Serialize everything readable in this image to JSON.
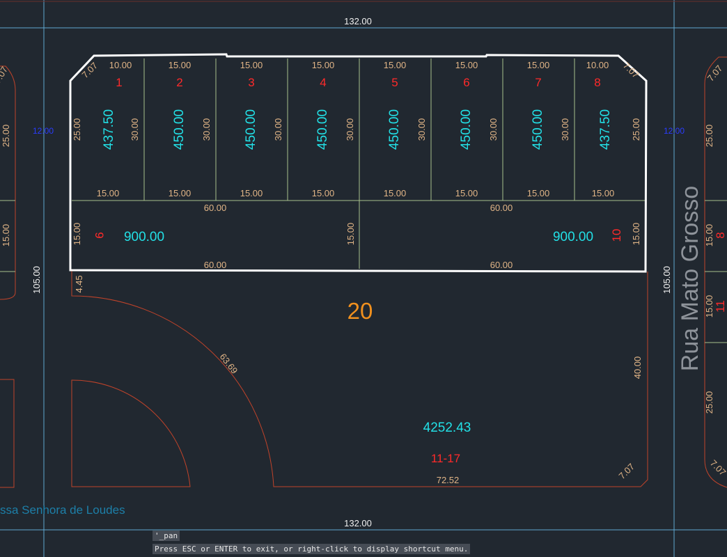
{
  "drawing": {
    "dim_top": "132.00",
    "dim_bottom": "132.00",
    "dim_left": "105.00",
    "dim_right": "105.00",
    "street_name": "Rua Mato Grosso",
    "street_name_bottom": "ssa Senhora de Loudes",
    "blue_label_left": "12.00",
    "blue_label_right": "12.00",
    "block_number": "20",
    "remainder_area": "4252.43",
    "remainder_lots": "11-17",
    "arc_length": "63.69",
    "bottom_edge": "72.52",
    "right_edge": "40.00",
    "left_offset": "4.45",
    "corner_chamfer": "7.07",
    "lots_top": [
      {
        "num": "1",
        "area": "437.50",
        "front": "10.00",
        "back": "15.00",
        "side": "25.00"
      },
      {
        "num": "2",
        "area": "450.00",
        "front": "15.00",
        "back": "15.00",
        "side": "30.00"
      },
      {
        "num": "3",
        "area": "450.00",
        "front": "15.00",
        "back": "15.00",
        "side": "30.00"
      },
      {
        "num": "4",
        "area": "450.00",
        "front": "15.00",
        "back": "15.00",
        "side": "30.00"
      },
      {
        "num": "5",
        "area": "450.00",
        "front": "15.00",
        "back": "15.00",
        "side": "30.00"
      },
      {
        "num": "6",
        "area": "450.00",
        "front": "15.00",
        "back": "15.00",
        "side": "30.00"
      },
      {
        "num": "7",
        "area": "450.00",
        "front": "15.00",
        "back": "15.00",
        "side": "30.00"
      },
      {
        "num": "8",
        "area": "437.50",
        "front": "10.00",
        "back": "15.00",
        "side": "30.00"
      }
    ],
    "lot_8_right_side": "25.00",
    "chamfer_left": "7.07",
    "chamfer_right": "7.07",
    "lot_9": {
      "num": "9",
      "area": "900.00",
      "top": "60.00",
      "bottom": "60.00",
      "side": "15.00",
      "inner_side": "15.00"
    },
    "lot_10": {
      "num": "10",
      "area": "900.00",
      "top": "60.00",
      "bottom": "60.00",
      "side": "15.00"
    },
    "adjacent_left": [
      "25.00",
      "15.00"
    ],
    "adjacent_right": [
      "25.00",
      "15.00",
      "15.00",
      "25.00",
      "7.07"
    ],
    "adjacent_right_red": [
      "8",
      "11"
    ],
    "adjacent_left_top": "7.07",
    "corner_bottom_right": "7.07"
  },
  "command_line": {
    "history": "'_pan",
    "prompt": "Press ESC or ENTER to exit, or right-click to display shortcut menu."
  },
  "colors": {
    "background": "#212830",
    "lot_lines": "#a8c08c",
    "boundary": "#c0432a",
    "selection": "#ffffff",
    "grid": "#5fa8d0"
  }
}
